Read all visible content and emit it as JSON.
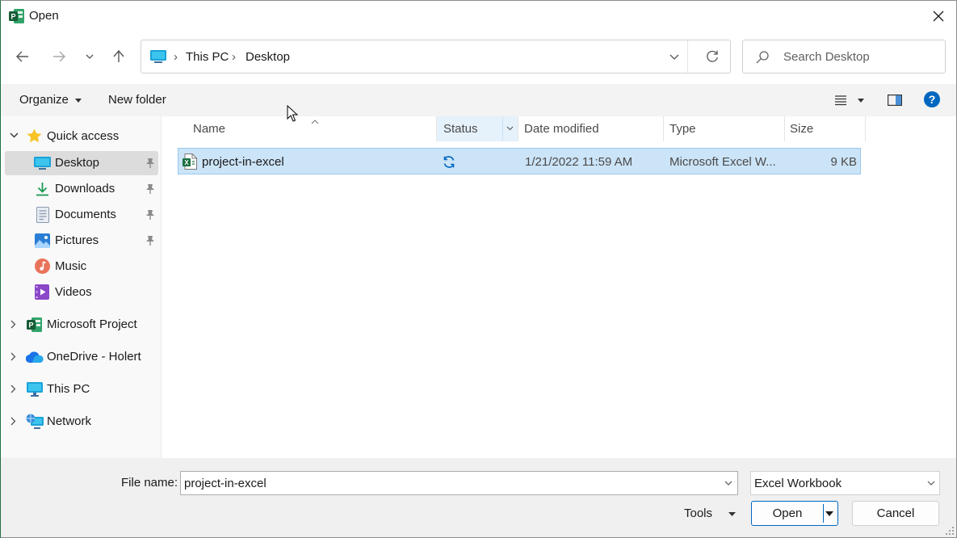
{
  "window": {
    "title": "Open"
  },
  "address": {
    "crumbs": [
      "This PC",
      "Desktop"
    ]
  },
  "search": {
    "placeholder": "Search Desktop"
  },
  "toolbar": {
    "organize_label": "Organize",
    "new_folder_label": "New folder"
  },
  "nav": {
    "quick_access": "Quick access",
    "items": [
      {
        "label": "Desktop",
        "icon": "desktop-icon",
        "pinned": true
      },
      {
        "label": "Downloads",
        "icon": "downloads-icon",
        "pinned": true
      },
      {
        "label": "Documents",
        "icon": "documents-icon",
        "pinned": true
      },
      {
        "label": "Pictures",
        "icon": "pictures-icon",
        "pinned": true
      },
      {
        "label": "Music",
        "icon": "music-icon",
        "pinned": false
      },
      {
        "label": "Videos",
        "icon": "videos-icon",
        "pinned": false
      }
    ],
    "roots": [
      {
        "label": "Microsoft Project",
        "icon": "microsoft-project-icon"
      },
      {
        "label": "OneDrive - Holert",
        "icon": "onedrive-icon"
      },
      {
        "label": "This PC",
        "icon": "this-pc-icon"
      },
      {
        "label": "Network",
        "icon": "network-icon"
      }
    ]
  },
  "columns": {
    "name": "Name",
    "status": "Status",
    "date": "Date modified",
    "type": "Type",
    "size": "Size"
  },
  "files": [
    {
      "name": "project-in-excel",
      "status_icon": "sync-icon",
      "date": "1/21/2022 11:59 AM",
      "type": "Microsoft Excel W...",
      "size": "9 KB",
      "icon": "excel-file-icon"
    }
  ],
  "footer": {
    "file_name_label": "File name:",
    "file_name_value": "project-in-excel",
    "filter_value": "Excel Workbook",
    "tools_label": "Tools",
    "open_label": "Open",
    "cancel_label": "Cancel"
  },
  "colors": {
    "accent": "#0067c0",
    "selection": "#cce4f7",
    "project_green": "#217346"
  }
}
